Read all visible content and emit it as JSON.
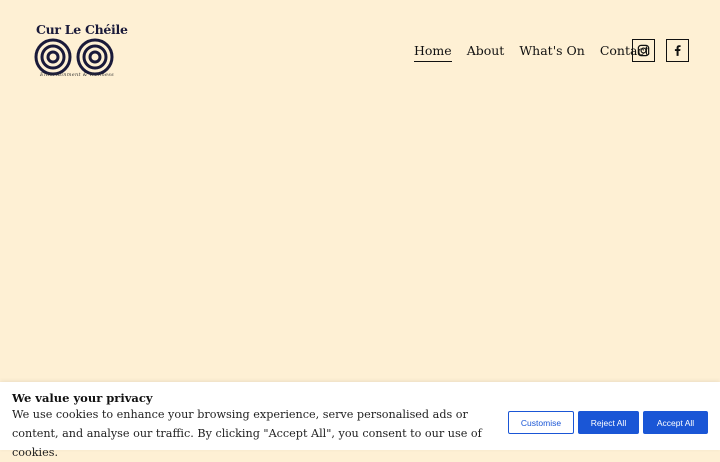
{
  "brand": {
    "name": "Cur Le Chéile",
    "tagline": "Entertainment & Wellness"
  },
  "nav": {
    "items": [
      "Home",
      "About",
      "What's On",
      "Contact"
    ],
    "active": "Home"
  },
  "social": {
    "instagram_icon": "instagram-icon",
    "facebook_icon": "facebook-icon"
  },
  "cookie_banner": {
    "title": "We value your privacy",
    "text": "We use cookies to enhance your browsing experience, serve personalised ads or content, and analyse our traffic. By clicking \"Accept All\", you consent to our use of cookies.",
    "customise_label": "Customise",
    "reject_label": "Reject All",
    "accept_label": "Accept All"
  },
  "colors": {
    "background": "#fef0d4",
    "button_blue": "#1a56d6"
  }
}
